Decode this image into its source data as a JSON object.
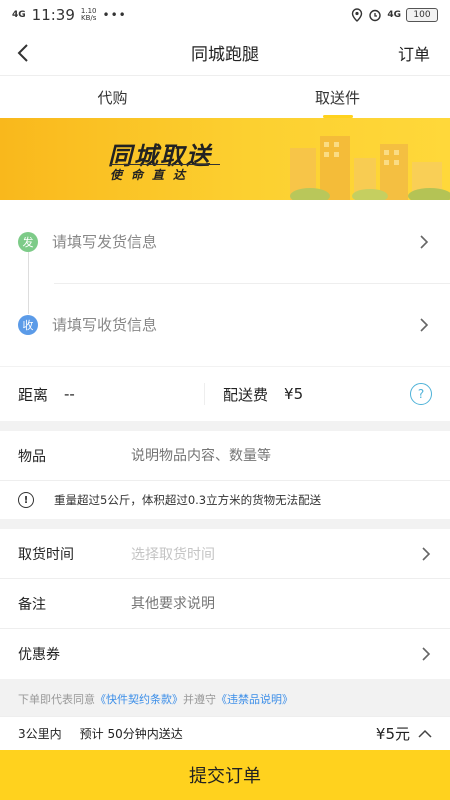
{
  "status_bar": {
    "network": "4G",
    "time": "11:39",
    "speed_value": "1.10",
    "speed_unit": "KB/s",
    "dots": "•••",
    "wifi_label": "4G",
    "battery": "100"
  },
  "nav": {
    "title": "同城跑腿",
    "right_label": "订单"
  },
  "tabs": [
    {
      "label": "代购",
      "active": false
    },
    {
      "label": "取送件",
      "active": true
    }
  ],
  "banner": {
    "title": "同城取送",
    "subtitle": "使命直达"
  },
  "address": {
    "send_badge": "发",
    "send_placeholder": "请填写发货信息",
    "recv_badge": "收",
    "recv_placeholder": "请填写收货信息"
  },
  "fee": {
    "distance_label": "距离",
    "distance_value": "--",
    "fee_label": "配送费",
    "fee_value": "¥5",
    "help": "?"
  },
  "item": {
    "label": "物品",
    "placeholder": "说明物品内容、数量等",
    "warning_icon": "!",
    "warning": "重量超过5公斤，体积超过0.3立方米的货物无法配送"
  },
  "schedule": {
    "time_label": "取货时间",
    "time_placeholder": "选择取货时间",
    "note_label": "备注",
    "note_placeholder": "其他要求说明",
    "coupon_label": "优惠券"
  },
  "agreement": {
    "prefix": "下单即代表同意",
    "link1": "《快件契约条款》",
    "middle": "并遵守",
    "link2": "《违禁品说明》"
  },
  "summary": {
    "range": "3公里内",
    "eta": "预计 50分钟内送达",
    "price": "¥5元"
  },
  "submit": {
    "label": "提交订单"
  },
  "colors": {
    "accent": "#ffd21e",
    "send_dot": "#7dcb88",
    "recv_dot": "#5b9be8",
    "link": "#3c8ee8"
  }
}
